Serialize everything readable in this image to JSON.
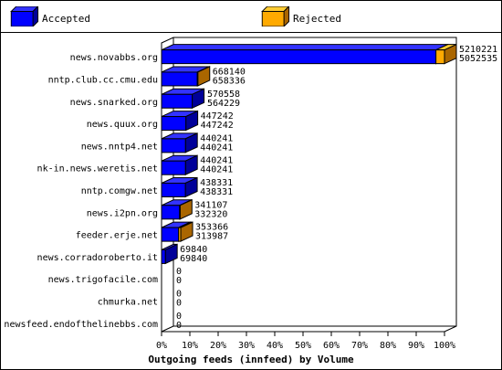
{
  "legend": {
    "accepted": "Accepted",
    "rejected": "Rejected"
  },
  "colors": {
    "accepted": "#0000ff",
    "accepted_top": "#3333ff",
    "accepted_side": "#000099",
    "rejected": "#ffaa00",
    "rejected_top": "#ffcc33",
    "rejected_side": "#aa6600",
    "axis": "#000000"
  },
  "chart_data": {
    "type": "bar",
    "orientation": "horizontal",
    "stacked": true,
    "percent_axis": true,
    "title": "",
    "xlabel": "Outgoing feeds (innfeed) by Volume",
    "ylabel": "",
    "xlim": [
      0,
      100
    ],
    "xticks": [
      "0%",
      "10%",
      "20%",
      "30%",
      "40%",
      "50%",
      "60%",
      "70%",
      "80%",
      "90%",
      "100%"
    ],
    "categories": [
      "news.novabbs.org",
      "nntp.club.cc.cmu.edu",
      "news.snarked.org",
      "news.quux.org",
      "news.nntp4.net",
      "nk-in.news.weretis.net",
      "nntp.comgw.net",
      "news.i2pn.org",
      "feeder.erje.net",
      "news.corradoroberto.it",
      "news.trigofacile.com",
      "chmurka.net",
      "newsfeed.endofthelinebbs.com"
    ],
    "totals": [
      "5210221",
      "668140",
      "570558",
      "447242",
      "440241",
      "440241",
      "438331",
      "341107",
      "353366",
      "69840",
      "0",
      "0",
      "0"
    ],
    "accepted_labels": [
      "5052535",
      "658336",
      "564229",
      "447242",
      "440241",
      "440241",
      "438331",
      "332320",
      "313987",
      "69840",
      "0",
      "0",
      "0"
    ],
    "series": [
      {
        "name": "Accepted",
        "values": [
          5052535,
          658336,
          564229,
          447242,
          440241,
          440241,
          438331,
          332320,
          313987,
          69840,
          0,
          0,
          0
        ]
      },
      {
        "name": "Rejected",
        "values": [
          157686,
          9804,
          6329,
          0,
          0,
          0,
          0,
          8787,
          39379,
          0,
          0,
          0,
          0
        ]
      }
    ]
  }
}
